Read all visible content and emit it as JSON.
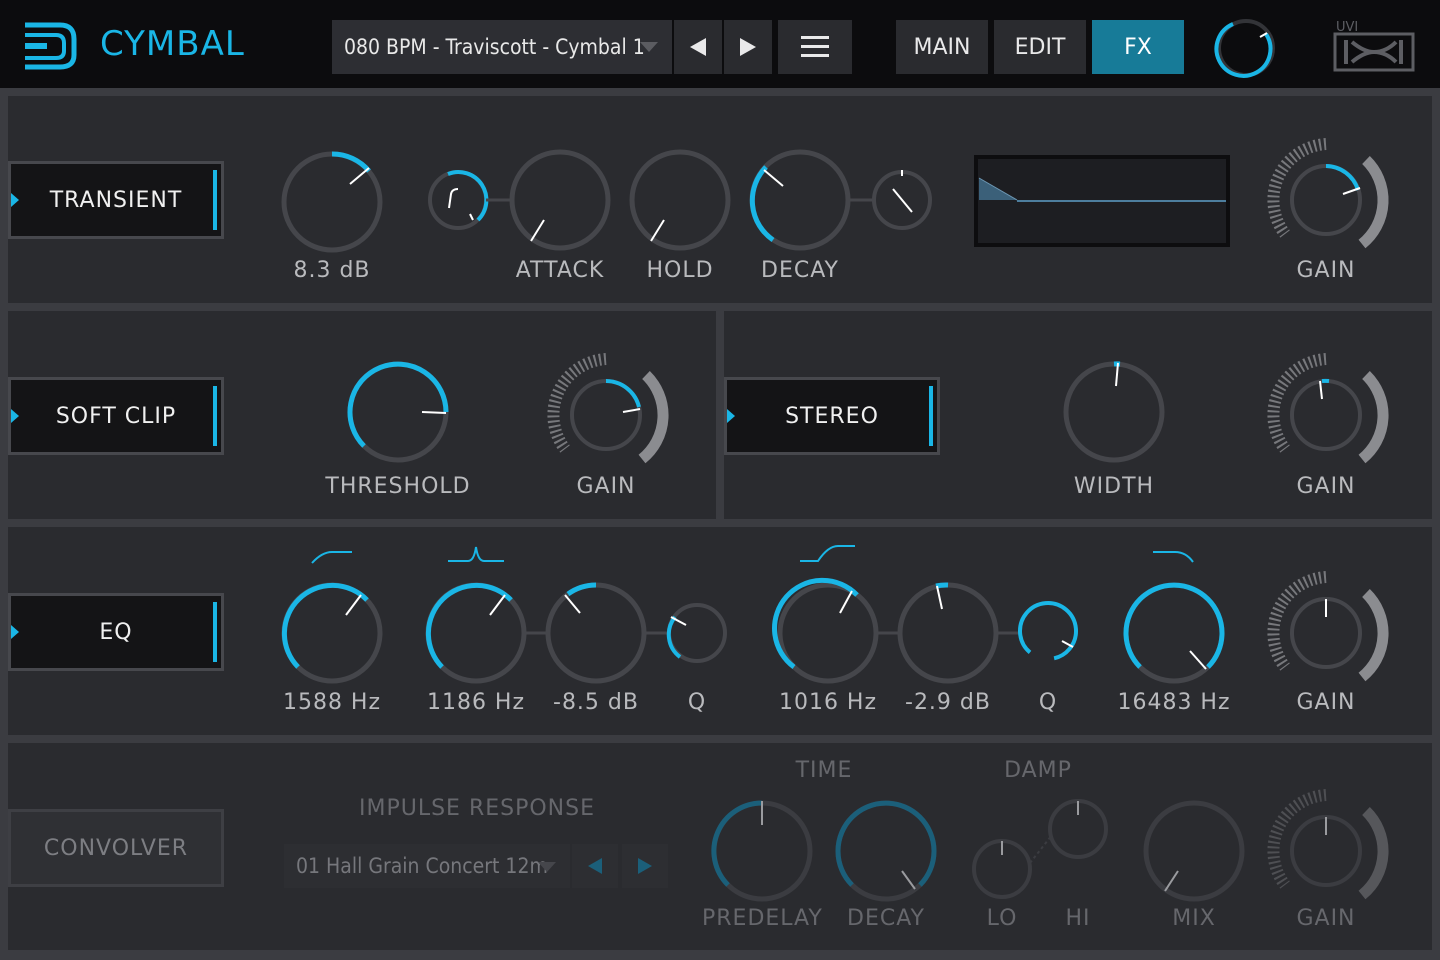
{
  "app": {
    "title": "CYMBAL",
    "brand": "UVI"
  },
  "preset": {
    "name": "080 BPM - Traviscott - Cymbal 1"
  },
  "nav": {
    "main": "MAIN",
    "edit": "EDIT",
    "fx": "FX",
    "active": "FX"
  },
  "colors": {
    "accent": "#1ab6e6",
    "active_tab": "#177b98",
    "background": "#2a2b2f",
    "topbar": "#0c0c0e"
  },
  "transient": {
    "button": "TRANSIENT",
    "amount_value": "8.3 dB",
    "attack_label": "ATTACK",
    "hold_label": "HOLD",
    "decay_label": "DECAY",
    "gain_label": "GAIN"
  },
  "softclip": {
    "button": "SOFT CLIP",
    "threshold_label": "THRESHOLD",
    "gain_label": "GAIN"
  },
  "stereo": {
    "button": "STEREO",
    "width_label": "WIDTH",
    "gain_label": "GAIN"
  },
  "eq": {
    "button": "EQ",
    "band1_freq": "1588 Hz",
    "band2_freq": "1186 Hz",
    "band2_gain": "-8.5 dB",
    "band2_q": "Q",
    "band3_freq": "1016 Hz",
    "band3_gain": "-2.9 dB",
    "band3_q": "Q",
    "band4_freq": "16483 Hz",
    "gain_label": "GAIN"
  },
  "convolver": {
    "button": "CONVOLVER",
    "ir_label": "IMPULSE RESPONSE",
    "ir_name": "01 Hall Grain Concert 12m",
    "time_label": "TIME",
    "damp_label": "DAMP",
    "predelay_label": "PREDELAY",
    "decay_label": "DECAY",
    "lo_label": "LO",
    "hi_label": "HI",
    "mix_label": "MIX",
    "gain_label": "GAIN"
  },
  "icons": [
    "cymbal-logo-icon",
    "dropdown-caret-icon",
    "prev-arrow-icon",
    "next-arrow-icon",
    "menu-icon",
    "master-volume-knob-icon",
    "uvi-logo-icon"
  ]
}
